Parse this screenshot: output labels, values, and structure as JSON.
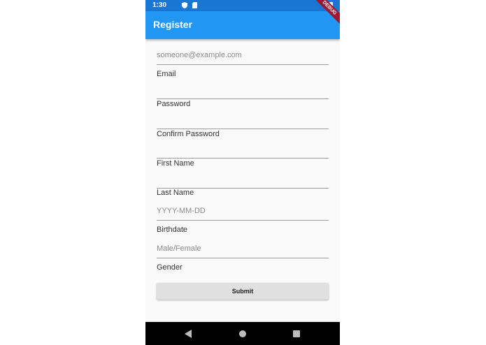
{
  "status_bar": {
    "time": "1:30",
    "icons": [
      "shield-icon",
      "sd-card-icon",
      "battery-icon"
    ]
  },
  "app_bar": {
    "title": "Register",
    "color": "#2196f3"
  },
  "debug_banner": "DEBUG",
  "form": {
    "fields": [
      {
        "label": "Email",
        "placeholder": "someone@example.com",
        "value": ""
      },
      {
        "label": "Password",
        "placeholder": "",
        "value": ""
      },
      {
        "label": "Confirm Password",
        "placeholder": "",
        "value": ""
      },
      {
        "label": "First Name",
        "placeholder": "",
        "value": ""
      },
      {
        "label": "Last Name",
        "placeholder": "",
        "value": ""
      },
      {
        "label": "Birthdate",
        "placeholder": "YYYY-MM-DD",
        "value": ""
      },
      {
        "label": "Gender",
        "placeholder": "Male/Female",
        "value": ""
      }
    ],
    "submit_label": "Submit"
  },
  "nav_bar": {
    "icons": [
      "back-icon",
      "home-icon",
      "recent-apps-icon"
    ]
  }
}
